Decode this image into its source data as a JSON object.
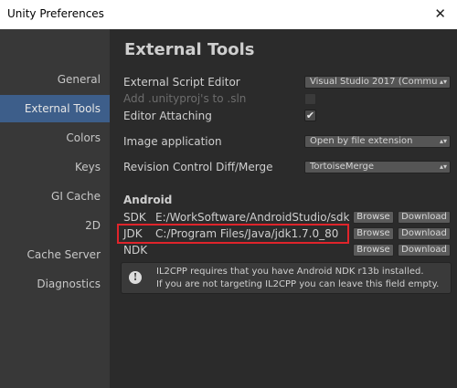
{
  "window": {
    "title": "Unity Preferences",
    "close_glyph": "✕"
  },
  "sidebar": {
    "items": [
      {
        "label": "General",
        "active": false
      },
      {
        "label": "External Tools",
        "active": true
      },
      {
        "label": "Colors",
        "active": false
      },
      {
        "label": "Keys",
        "active": false
      },
      {
        "label": "GI Cache",
        "active": false
      },
      {
        "label": "2D",
        "active": false
      },
      {
        "label": "Cache Server",
        "active": false
      },
      {
        "label": "Diagnostics",
        "active": false
      }
    ]
  },
  "main": {
    "heading": "External Tools",
    "script_editor": {
      "label": "External Script Editor",
      "value": "Visual Studio 2017 (Commu"
    },
    "unityproj": {
      "label": "Add .unityproj's to .sln",
      "checked": false,
      "disabled": true
    },
    "editor_attaching": {
      "label": "Editor Attaching",
      "checked": true,
      "check_glyph": "✔"
    },
    "image_app": {
      "label": "Image application",
      "value": "Open by file extension"
    },
    "revision_control": {
      "label": "Revision Control Diff/Merge",
      "value": "TortoiseMerge"
    },
    "android": {
      "title": "Android",
      "sdk": {
        "label": "SDK",
        "path": "E:/WorkSoftware/AndroidStudio/sdk"
      },
      "jdk": {
        "label": "JDK",
        "path": "C:/Program Files/Java/jdk1.7.0_80"
      },
      "ndk": {
        "label": "NDK",
        "path": ""
      },
      "browse_label": "Browse",
      "download_label": "Download"
    },
    "info": {
      "icon_glyph": "!",
      "line1": "IL2CPP requires that you have Android NDK r13b installed.",
      "line2": "If you are not targeting IL2CPP you can leave this field empty."
    },
    "dropdown_arrow": "▴▾"
  },
  "colors": {
    "selection": "#3d5e8a",
    "highlight_box": "#e0242b"
  }
}
